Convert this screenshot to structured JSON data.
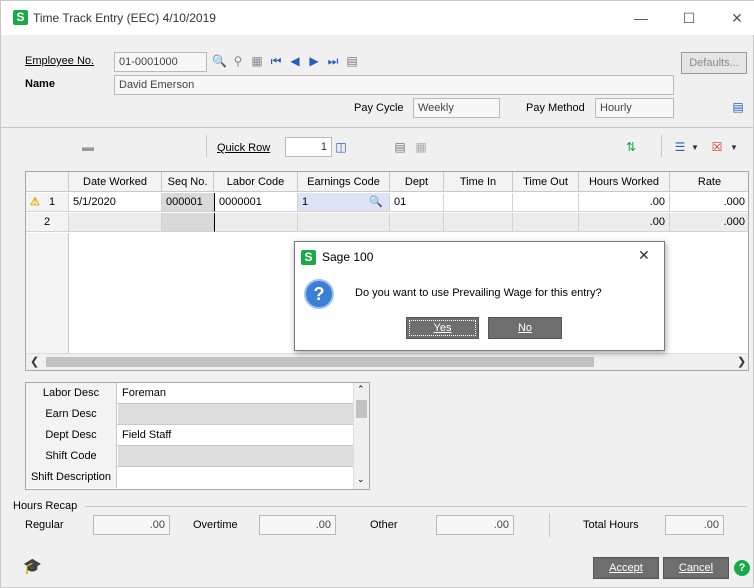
{
  "window": {
    "title": "Time Track Entry (EEC) 4/10/2019",
    "minimize_glyph": "—",
    "maximize_glyph": "☐",
    "close_glyph": "✕"
  },
  "header": {
    "employee_label": "Employee No.",
    "employee_value": "01-0001000",
    "name_label": "Name",
    "name_value": "David Emerson",
    "defaults_label": "Defaults...",
    "pay_cycle_label": "Pay Cycle",
    "pay_cycle_value": "Weekly",
    "pay_method_label": "Pay Method",
    "pay_method_value": "Hourly"
  },
  "toolbar": {
    "quick_row_label": "Quick Row",
    "quick_row_value": "1"
  },
  "grid": {
    "columns": [
      "Date Worked",
      "Seq No.",
      "Labor Code",
      "Earnings Code",
      "Dept",
      "Time In",
      "Time Out",
      "Hours Worked",
      "Rate"
    ],
    "rows": [
      {
        "num": "1",
        "date": "5/1/2020",
        "seq": "000001",
        "labor": "0000001",
        "earn": "1",
        "dept": "01",
        "time_in": "",
        "time_out": "",
        "hours": ".00",
        "rate": ".000"
      },
      {
        "num": "2",
        "date": "",
        "seq": "",
        "labor": "",
        "earn": "",
        "dept": "",
        "time_in": "",
        "time_out": "",
        "hours": ".00",
        "rate": ".000"
      }
    ]
  },
  "details": [
    {
      "label": "Labor Desc",
      "value": "Foreman"
    },
    {
      "label": "Earn Desc",
      "value": ""
    },
    {
      "label": "Dept Desc",
      "value": "Field Staff"
    },
    {
      "label": "Shift Code",
      "value": ""
    },
    {
      "label": "Shift Description",
      "value": ""
    }
  ],
  "recap": {
    "title": "Hours Recap",
    "regular_label": "Regular",
    "regular_value": ".00",
    "overtime_label": "Overtime",
    "overtime_value": ".00",
    "other_label": "Other",
    "other_value": ".00",
    "total_label": "Total Hours",
    "total_value": ".00"
  },
  "footer": {
    "accept_label": "Accept",
    "cancel_label": "Cancel"
  },
  "dialog": {
    "title": "Sage 100",
    "message": "Do you want to use Prevailing Wage for this entry?",
    "yes_label": "Yes",
    "no_label": "No"
  },
  "colors": {
    "sage_green": "#1ea64b",
    "dialog_button": "#6e6e6e",
    "link_blue": "#0033cc"
  }
}
